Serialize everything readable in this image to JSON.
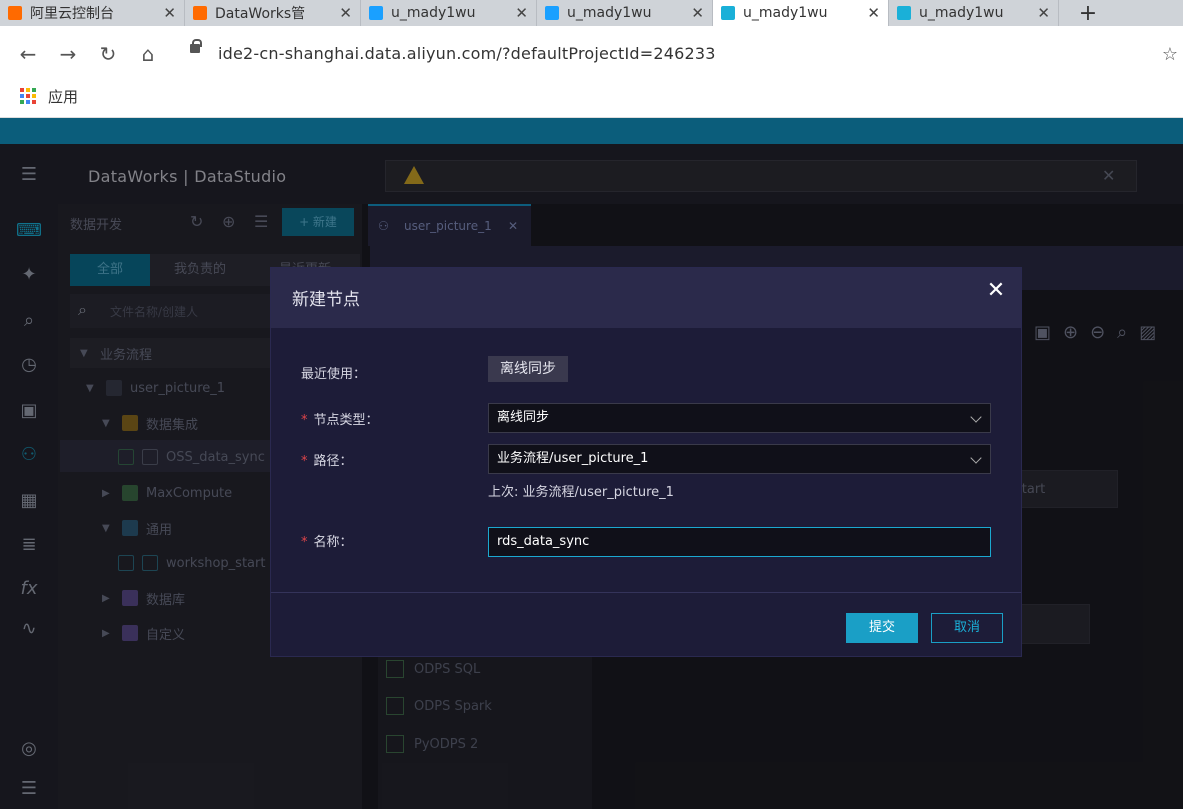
{
  "browser": {
    "tabs": [
      {
        "label": "阿里云控制台",
        "color": "#ff6a00"
      },
      {
        "label": "DataWorks管",
        "color": "#ff6a00"
      },
      {
        "label": "u_mady1wu",
        "color": "#1aa0ff"
      },
      {
        "label": "u_mady1wu",
        "color": "#1aa0ff"
      },
      {
        "label": "u_mady1wu",
        "color": "#1ab0d8"
      },
      {
        "label": "u_mady1wu",
        "color": "#1ab0d8"
      }
    ],
    "active_tab": 4,
    "url": "ide2-cn-shanghai.data.aliyun.com/?defaultProjectId=246233",
    "bookmarks_apps_label": "应用"
  },
  "app": {
    "brand": "DataWorks | DataStudio",
    "sidebar": {
      "title": "数据开发",
      "new_button": "+ 新建",
      "tabs": [
        "全部",
        "我负责的",
        "最近更新"
      ],
      "search_placeholder": "文件名称/创建人",
      "tree": [
        {
          "label": "业务流程",
          "level": 0
        },
        {
          "label": "user_picture_1",
          "level": 1
        },
        {
          "label": "数据集成",
          "level": 2
        },
        {
          "label": "OSS_data_sync",
          "level": 3
        },
        {
          "label": "MaxCompute",
          "level": 2
        },
        {
          "label": "通用",
          "level": 2
        },
        {
          "label": "workshop_start",
          "level": 3
        },
        {
          "label": "数据库",
          "level": 2
        },
        {
          "label": "自定义",
          "level": 2
        }
      ]
    },
    "editor_tab": "user_picture_1",
    "canvas_node_label": "start",
    "node_list": [
      "ODPS SQL",
      "ODPS Spark",
      "PyODPS 2"
    ]
  },
  "dialog": {
    "title": "新建节点",
    "recent_label": "最近使用：",
    "recent_value": "离线同步",
    "node_type_label": "节点类型：",
    "node_type_value": "离线同步",
    "path_label": "路径：",
    "path_value": "业务流程/user_picture_1",
    "path_hint": "上次: 业务流程/user_picture_1",
    "name_label": "名称：",
    "name_value": "rds_data_sync",
    "submit": "提交",
    "cancel": "取消"
  }
}
